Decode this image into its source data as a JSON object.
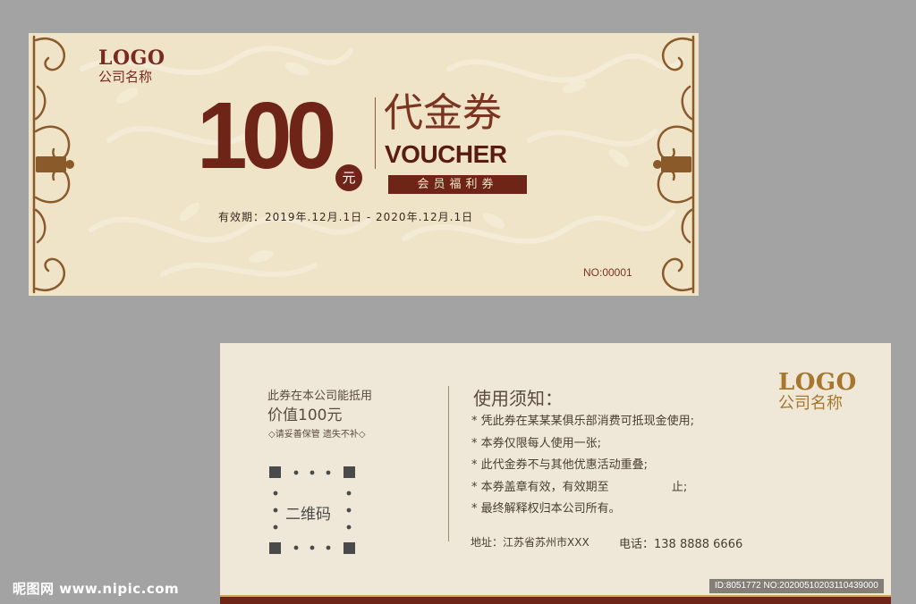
{
  "front": {
    "logo": "LOGO",
    "company": "公司名称",
    "amount": "100",
    "currency": "元",
    "title_cn": "代金券",
    "title_en": "VOUCHER",
    "badge": "会员福利券",
    "validity": "有效期：2019年.12月.1日 - 2020年.12月.1日",
    "serial": "NO:00001"
  },
  "back": {
    "desc_line1": "此券在本公司能抵用",
    "desc_line2": "价值100元",
    "desc_line3": "◇请妥善保管 遗失不补◇",
    "qr_label": "二维码",
    "notice_title": "使用须知：",
    "rules": [
      "* 凭此券在某某某俱乐部消费可抵现金使用;",
      "* 本券仅限每人使用一张;",
      "* 此代金券不与其他优惠活动重叠;",
      "* 本券盖章有效，有效期至                 止;",
      "* 最终解释权归本公司所有。"
    ],
    "address": "地址：江苏省苏州市XXX",
    "phone": "电话：138 8888 6666",
    "logo": "LOGO",
    "company": "公司名称"
  },
  "watermark": {
    "site": "昵图网 www.nipic.com",
    "id_text": "ID:8051772 NO:20200510203110439000"
  },
  "colors": {
    "background": "#a3a3a3",
    "front_card": "#efe3c8",
    "back_card": "#efe8d8",
    "maroon": "#6e2416",
    "gold": "#a8772e"
  }
}
